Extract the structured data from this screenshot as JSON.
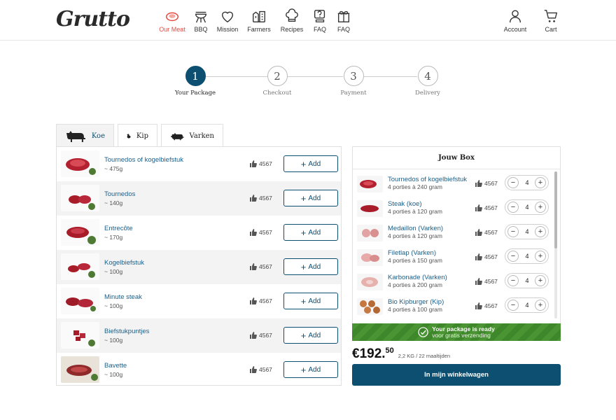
{
  "brand": {
    "logo": "Grutto"
  },
  "nav": {
    "items": [
      {
        "label": "Our Meat",
        "icon": "steak-icon",
        "active": true
      },
      {
        "label": "BBQ",
        "icon": "grill-icon"
      },
      {
        "label": "Mission",
        "icon": "heart-icon"
      },
      {
        "label": "Farmers",
        "icon": "farm-icon"
      },
      {
        "label": "Recipes",
        "icon": "chef-hat-icon"
      },
      {
        "label": "FAQ",
        "icon": "faq-icon"
      },
      {
        "label": "FAQ",
        "icon": "gift-box-icon"
      }
    ],
    "right": [
      {
        "label": "Account",
        "icon": "user-icon"
      },
      {
        "label": "Cart",
        "icon": "cart-icon"
      }
    ]
  },
  "steps": [
    {
      "number": "1",
      "label": "Your Package",
      "active": true
    },
    {
      "number": "2",
      "label": "Checkout"
    },
    {
      "number": "3",
      "label": "Payment"
    },
    {
      "number": "4",
      "label": "Delivery"
    }
  ],
  "tabs": [
    {
      "label": "Koe",
      "icon": "cow-icon",
      "active": true
    },
    {
      "label": "Kip",
      "icon": "chicken-icon"
    },
    {
      "label": "Varken",
      "icon": "pig-icon"
    }
  ],
  "products": [
    {
      "name": "Tournedos of kogelbiefstuk",
      "weight": "~ 475g",
      "likes": "4567"
    },
    {
      "name": "Tournedos",
      "weight": "~ 140g",
      "likes": "4567"
    },
    {
      "name": "Entrecôte",
      "weight": "~ 170g",
      "likes": "4567"
    },
    {
      "name": "Kogelbiefstuk",
      "weight": "~ 100g",
      "likes": "4567"
    },
    {
      "name": "Minute steak",
      "weight": "~ 100g",
      "likes": "4567"
    },
    {
      "name": "Biefstukpuntjes",
      "weight": "~ 100g",
      "likes": "4567"
    },
    {
      "name": "Bavette",
      "weight": "~ 100g",
      "likes": "4567"
    }
  ],
  "product_add_label": "Add",
  "box": {
    "title": "Jouw Box",
    "items": [
      {
        "name": "Tournedos of kogelbiefstuk",
        "portions": "4 porties à 240 gram",
        "likes": "4567",
        "qty": "4"
      },
      {
        "name": "Steak (koe)",
        "portions": "4 porties à 120 gram",
        "likes": "4567",
        "qty": "4"
      },
      {
        "name": "Medaillon (Varken)",
        "portions": "4 porties à 120 gram",
        "likes": "4567",
        "qty": "4"
      },
      {
        "name": "Filetlap (Varken)",
        "portions": "4 porties à 150 gram",
        "likes": "4567",
        "qty": "4"
      },
      {
        "name": "Karbonade (Varken)",
        "portions": "4 porties à 200 gram",
        "likes": "4567",
        "qty": "4"
      },
      {
        "name": "Bio Kipburger (Kip)",
        "portions": "4 porties à 100 gram",
        "likes": "4567",
        "qty": "4"
      }
    ],
    "ready_main": "Your package is ready",
    "ready_sub": "voor gratis verzending"
  },
  "summary": {
    "price_main": "€192.",
    "price_cents": "50",
    "meta": "2,2 KG / 22 maaltijden",
    "cart_button": "In mijn winkelwagen"
  },
  "colors": {
    "accent": "#0d4f70",
    "active_nav": "#e4493f",
    "ready_green": "#4a9434",
    "link": "#1a5f8a"
  }
}
